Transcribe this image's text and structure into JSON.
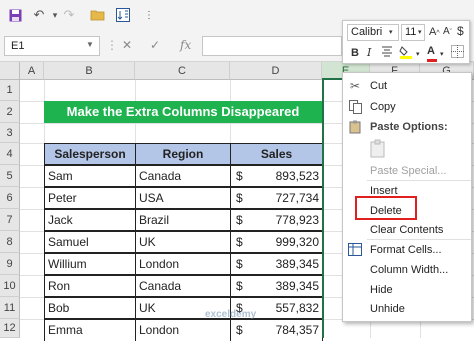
{
  "toolbar": {
    "icons": [
      "save-icon",
      "undo-icon",
      "redo-icon",
      "open-folder-icon",
      "sort-icon",
      "customize-icon"
    ]
  },
  "formula_bar": {
    "name_box": "E1",
    "fx": "fx",
    "cancel": "✕",
    "enter": "✓",
    "formula": ""
  },
  "columns": [
    "A",
    "B",
    "C",
    "D",
    "E",
    "F",
    "G"
  ],
  "rows": [
    "1",
    "2",
    "3",
    "4",
    "5",
    "6",
    "7",
    "8",
    "9",
    "10",
    "11",
    "12"
  ],
  "title": "Make the Extra Columns Disappeared",
  "table": {
    "headers": [
      "Salesperson",
      "Region",
      "Sales"
    ],
    "currency": "$",
    "rows": [
      {
        "name": "Sam",
        "region": "Canada",
        "sales": "893,523"
      },
      {
        "name": "Peter",
        "region": "USA",
        "sales": "727,734"
      },
      {
        "name": "Jack",
        "region": "Brazil",
        "sales": "778,923"
      },
      {
        "name": "Samuel",
        "region": "UK",
        "sales": "999,320"
      },
      {
        "name": "Willium",
        "region": "London",
        "sales": "389,345"
      },
      {
        "name": "Ron",
        "region": "Canada",
        "sales": "389,345"
      },
      {
        "name": "Bob",
        "region": "UK",
        "sales": "557,832"
      },
      {
        "name": "Emma",
        "region": "London",
        "sales": "784,357"
      }
    ]
  },
  "mini_toolbar": {
    "font": "Calibri",
    "size": "11",
    "bold": "B",
    "italic": "I",
    "font_color_letter": "A"
  },
  "context_menu": {
    "cut": "Cut",
    "copy": "Copy",
    "paste_options": "Paste Options:",
    "paste_special": "Paste Special...",
    "insert": "Insert",
    "delete": "Delete",
    "clear_contents": "Clear Contents",
    "format_cells": "Format Cells...",
    "column_width": "Column Width...",
    "hide": "Hide",
    "unhide": "Unhide"
  },
  "watermark": "exceldemy",
  "colors": {
    "title_bg": "#1fb350",
    "header_bg": "#b4c6e7",
    "highlight": "#e21f1f",
    "selection": "#217346"
  }
}
